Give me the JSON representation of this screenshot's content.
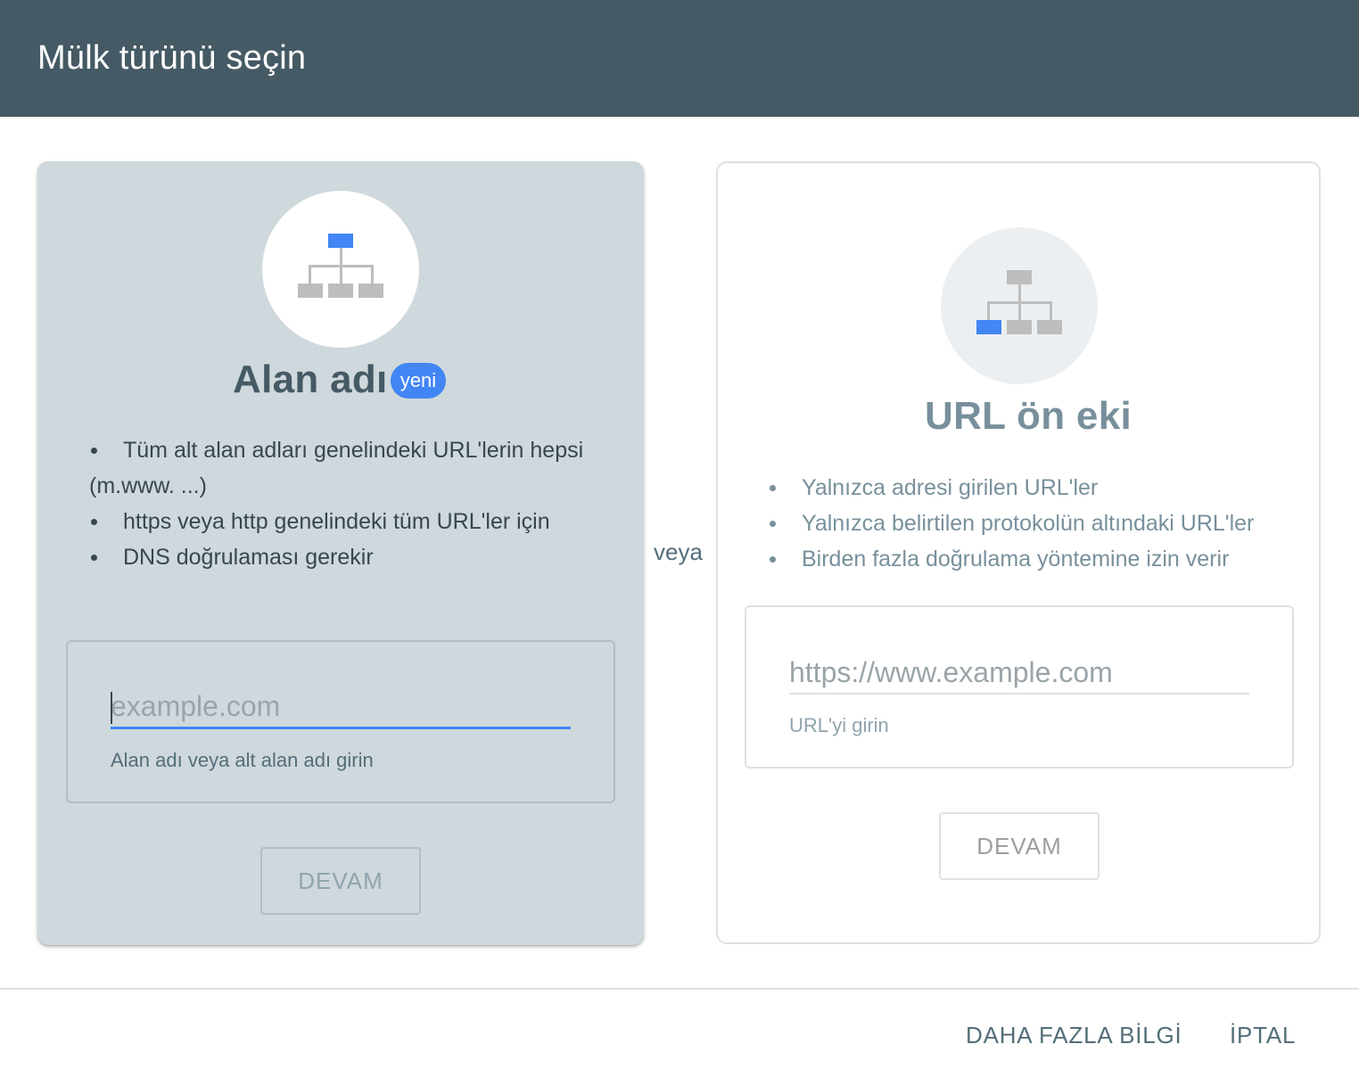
{
  "dialog": {
    "title": "Mülk türünü seçin"
  },
  "domain_option": {
    "title": "Alan adı",
    "badge": "yeni",
    "icon": "sitemap-root-highlighted-icon",
    "bullets": [
      "Tüm alt alan adları genelindeki URL'lerin hepsi (m.www. ...)",
      "https veya http genelindeki tüm URL'ler için",
      "DNS doğrulaması gerekir"
    ],
    "input": {
      "placeholder": "example.com",
      "value": "",
      "helper": "Alan adı veya alt alan adı girin"
    },
    "continue_label": "DEVAM"
  },
  "separator": {
    "label": "veya"
  },
  "url_prefix_option": {
    "title": "URL ön eki",
    "icon": "sitemap-child-highlighted-icon",
    "bullets": [
      "Yalnızca adresi girilen URL'ler",
      "Yalnızca belirtilen protokolün altındaki URL'ler",
      "Birden fazla doğrulama yöntemine izin verir"
    ],
    "input": {
      "placeholder": "https://www.example.com",
      "value": "",
      "helper": "URL'yi girin"
    },
    "continue_label": "DEVAM"
  },
  "footer": {
    "learn_more_label": "DAHA FAZLA BİLGİ",
    "cancel_label": "İPTAL"
  },
  "colors": {
    "header_bg": "#455a64",
    "selected_card_bg": "#cfd8dc",
    "accent_blue": "#4285f4",
    "icon_gray": "#bdbdbd"
  }
}
